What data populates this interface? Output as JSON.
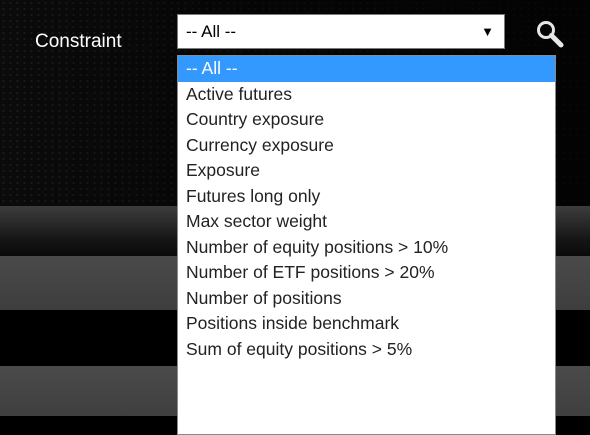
{
  "filter": {
    "label": "Constraint",
    "selected_value": "-- All --",
    "arrow_glyph": "▼",
    "search_icon": "search-icon"
  },
  "dropdown": {
    "highlighted_index": 0,
    "highlight_color": "#3399ff",
    "options": [
      "-- All --",
      "Active futures",
      "Country exposure",
      "Currency exposure",
      "Exposure",
      "Futures long only",
      "Max sector weight",
      "Number of equity positions > 10%",
      "Number of ETF positions > 20%",
      "Number of positions",
      "Positions inside benchmark",
      "Sum of equity positions > 5%"
    ]
  }
}
